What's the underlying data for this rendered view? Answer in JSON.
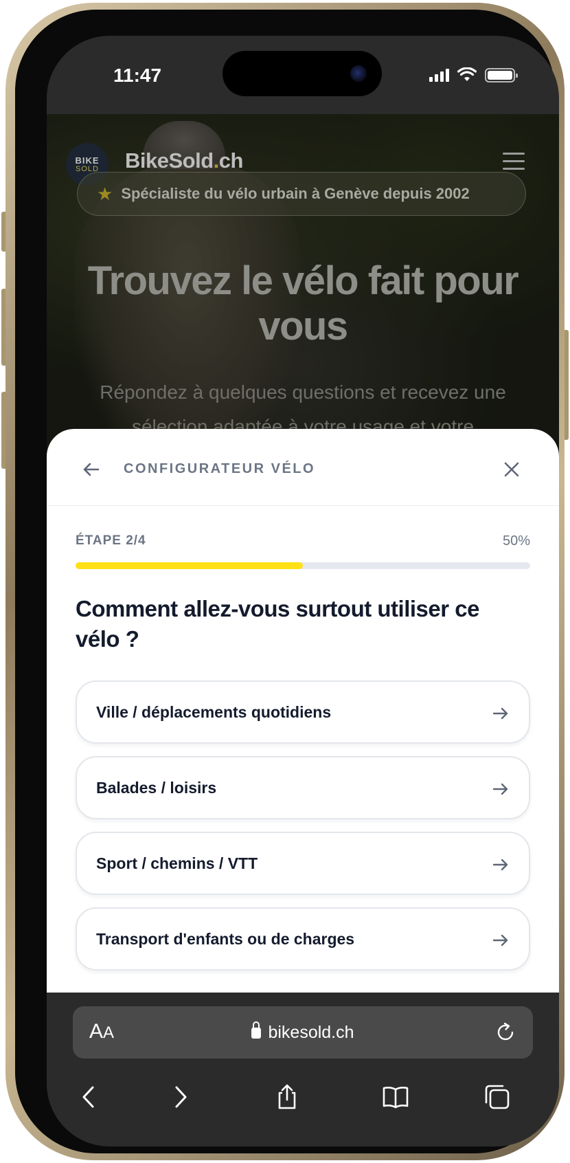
{
  "status_bar": {
    "time": "11:47",
    "icons": [
      "cellular-signal-icon",
      "wifi-icon",
      "battery-icon"
    ]
  },
  "site": {
    "logo_line1": "BIKE",
    "logo_line2": "SOLD",
    "brand_name": "BikeSold",
    "brand_dot": ".",
    "brand_tld": "ch",
    "menu_icon": "hamburger-menu-icon",
    "badge_icon": "star-icon",
    "badge_text": "Spécialiste du vélo urbain à Genève depuis 2002",
    "hero_title": "Trouvez le vélo fait pour vous",
    "hero_subtitle": "Répondez à quelques questions et recevez une sélection adaptée à votre usage et votre"
  },
  "configurator": {
    "title": "CONFIGURATEUR VÉLO",
    "back_icon": "arrow-left-icon",
    "close_icon": "close-icon",
    "step_label": "ÉTAPE 2/4",
    "progress_label": "50%",
    "progress_fraction": 0.5,
    "progress_color": "#ffe015",
    "question": "Comment allez-vous surtout utiliser ce vélo ?",
    "options": [
      {
        "label": "Ville / déplacements quotidiens",
        "icon": "arrow-right-icon"
      },
      {
        "label": "Balades / loisirs",
        "icon": "arrow-right-icon"
      },
      {
        "label": "Sport / chemins / VTT",
        "icon": "arrow-right-icon"
      },
      {
        "label": "Transport d'enfants ou de charges",
        "icon": "arrow-right-icon"
      }
    ]
  },
  "browser": {
    "text_size_label_big": "A",
    "text_size_label_small": "A",
    "url": "bikesold.ch",
    "lock_icon": "lock-icon",
    "reload_icon": "reload-icon",
    "toolbar": [
      "back-icon",
      "forward-icon",
      "share-icon",
      "bookmarks-icon",
      "tabs-icon"
    ]
  }
}
